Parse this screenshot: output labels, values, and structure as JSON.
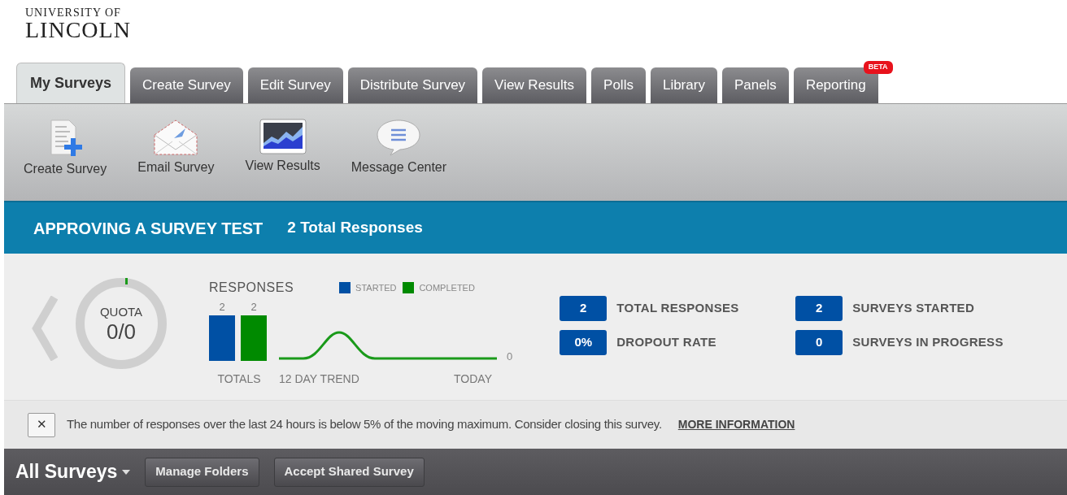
{
  "logo": {
    "line_1": "UNIVERSITY OF",
    "line_2": "LINCOLN"
  },
  "tabs": [
    {
      "label": "My Surveys",
      "selected": true
    },
    {
      "label": "Create Survey",
      "selected": false
    },
    {
      "label": "Edit Survey",
      "selected": false
    },
    {
      "label": "Distribute Survey",
      "selected": false
    },
    {
      "label": "View Results",
      "selected": false
    },
    {
      "label": "Polls",
      "selected": false
    },
    {
      "label": "Library",
      "selected": false
    },
    {
      "label": "Panels",
      "selected": false
    },
    {
      "label": "Reporting",
      "selected": false,
      "badge": "BETA"
    }
  ],
  "toolbar": [
    {
      "kind": "create",
      "label": "Create Survey"
    },
    {
      "kind": "email",
      "label": "Email Survey"
    },
    {
      "kind": "results",
      "label": "View Results"
    },
    {
      "kind": "message",
      "label": "Message Center"
    }
  ],
  "survey": {
    "title": "APPROVING A SURVEY TEST",
    "responses": "2 Total Responses"
  },
  "quota": {
    "label": "QUOTA",
    "value": "0/0"
  },
  "responses": {
    "title": "RESPONSES",
    "chart_data": {
      "type": "bar",
      "xlabel": "TOTALS",
      "data_labels": true,
      "series": [
        {
          "name": "STARTED",
          "color": "#0050a4",
          "values": [
            2
          ]
        },
        {
          "name": "COMPLETED",
          "color": "#008a00",
          "values": [
            2
          ]
        }
      ]
    },
    "trend": {
      "label": "12 DAY TREND",
      "end_label": "TODAY",
      "last_value": "0"
    }
  },
  "stats": [
    {
      "value": "2",
      "label": "TOTAL RESPONSES"
    },
    {
      "value": "2",
      "label": "SURVEYS STARTED"
    },
    {
      "value": "0%",
      "label": "DROPOUT RATE"
    },
    {
      "value": "0",
      "label": "SURVEYS IN PROGRESS"
    }
  ],
  "notice": {
    "close": "✕",
    "text": "The number of responses over the last 24 hours is below 5% of the moving maximum. Consider closing this survey.",
    "link": "MORE INFORMATION"
  },
  "bottom_bar": {
    "title": "All Surveys",
    "buttons": [
      "Manage Folders",
      "Accept Shared Survey"
    ]
  }
}
